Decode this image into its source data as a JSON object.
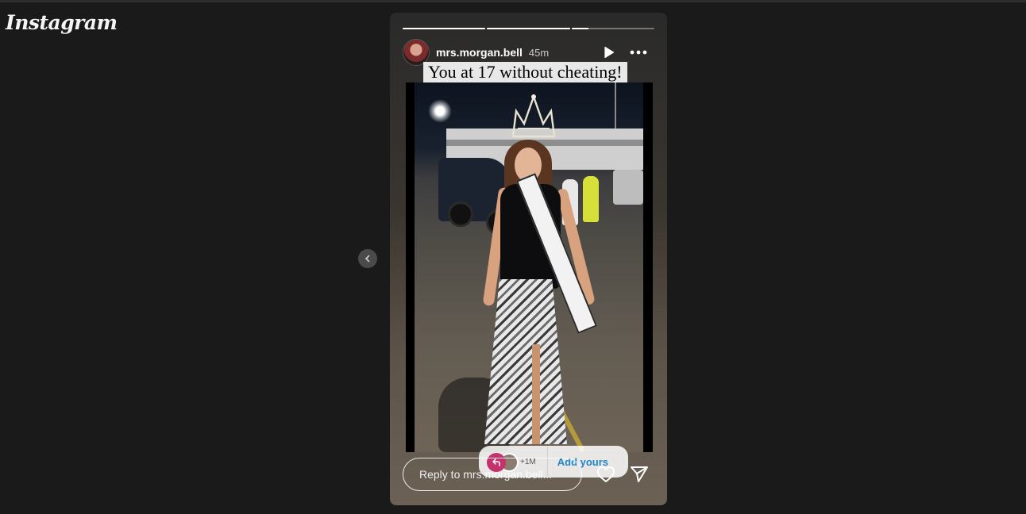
{
  "app": {
    "logo_text": "Instagram"
  },
  "navigation": {
    "prev_icon": "chevron-left-icon"
  },
  "story": {
    "progress": [
      1.0,
      1.0,
      0.2
    ],
    "user": {
      "username": "mrs.morgan.bell",
      "time_ago": "45m"
    },
    "controls": {
      "play_icon": "play-icon",
      "more_icon": "more-horizontal-icon"
    },
    "caption": "You at 17 without cheating!",
    "add_yours": {
      "count": "+1M",
      "label": "Add yours",
      "icon": "reply-arrow-icon"
    },
    "reply": {
      "placeholder": "Reply to mrs.morgan.bell..."
    },
    "actions": {
      "like_icon": "heart-icon",
      "share_icon": "send-icon"
    }
  }
}
